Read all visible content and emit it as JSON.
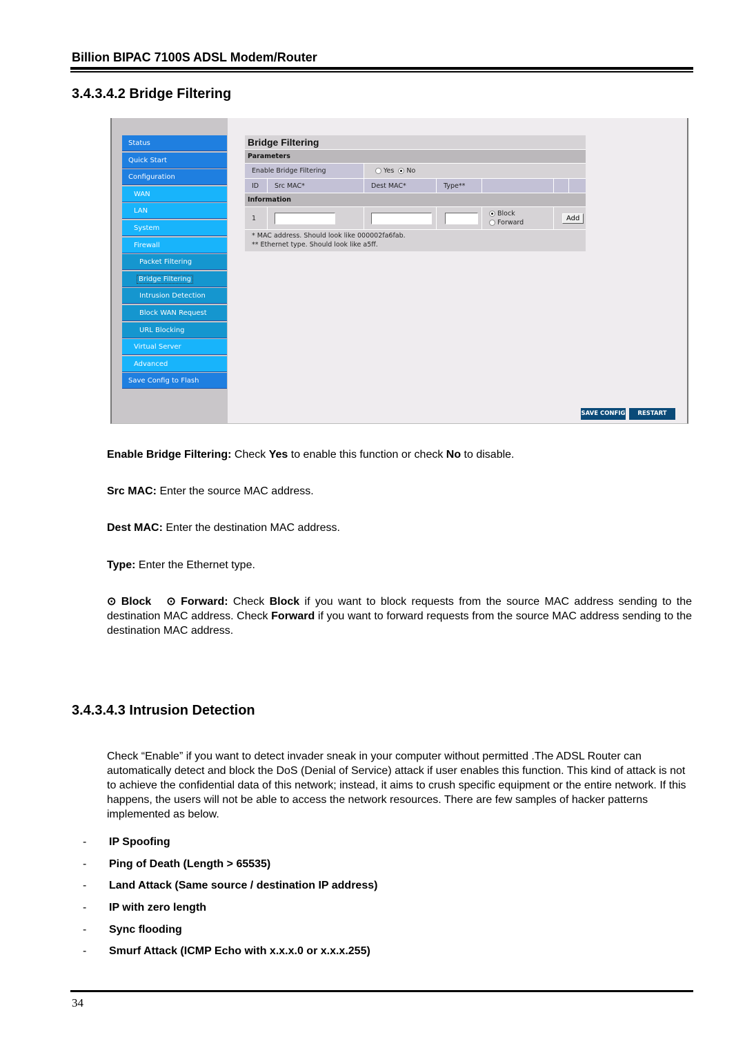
{
  "header": {
    "title": "Billion BIPAC 7100S ADSL Modem/Router"
  },
  "section1": {
    "heading": "3.4.3.4.2 Bridge Filtering"
  },
  "screenshot": {
    "sidebar": {
      "items": [
        {
          "label": "Status",
          "level": 0
        },
        {
          "label": "Quick Start",
          "level": 0
        },
        {
          "label": "Configuration",
          "level": 0
        },
        {
          "label": "WAN",
          "level": 1
        },
        {
          "label": "LAN",
          "level": 1
        },
        {
          "label": "System",
          "level": 1
        },
        {
          "label": "Firewall",
          "level": 1
        },
        {
          "label": "Packet Filtering",
          "level": 2
        },
        {
          "label": "Bridge Filtering",
          "level": 2,
          "active": true
        },
        {
          "label": "Intrusion Detection",
          "level": 2
        },
        {
          "label": "Block WAN Request",
          "level": 2
        },
        {
          "label": "URL Blocking",
          "level": 2
        },
        {
          "label": "Virtual Server",
          "level": 1
        },
        {
          "label": "Advanced",
          "level": 1
        },
        {
          "label": "Save Config to Flash",
          "level": 0
        }
      ]
    },
    "panel": {
      "title": "Bridge Filtering",
      "parameters_label": "Parameters",
      "enable_label": "Enable Bridge Filtering",
      "enable_options": {
        "yes": "Yes",
        "no": "No",
        "selected": "No"
      },
      "columns": {
        "id": "ID",
        "src_mac": "Src MAC*",
        "dest_mac": "Dest MAC*",
        "type": "Type**"
      },
      "information_label": "Information",
      "row": {
        "id": "1",
        "src_mac_value": "",
        "dest_mac_value": "",
        "type_value": "",
        "action_options": {
          "block": "Block",
          "forward": "Forward",
          "selected": "Block"
        },
        "add_label": "Add"
      },
      "notes": [
        "* MAC address. Should look like 000002fa6fab.",
        "** Ethernet type. Should look like a5ff."
      ]
    },
    "buttons": {
      "save_config": "SAVE CONFIG",
      "restart": "RESTART"
    }
  },
  "descriptions": {
    "enable": {
      "term": "Enable Bridge Filtering:",
      "t1": " Check ",
      "b1": "Yes",
      "t2": " to enable this function or check ",
      "b2": "No",
      "t3": " to disable."
    },
    "src": {
      "term": "Src MAC:",
      "text": " Enter the source MAC address."
    },
    "dest": {
      "term": "Dest MAC:",
      "text": " Enter the destination MAC address."
    },
    "type": {
      "term": "Type:",
      "text": " Enter the Ethernet type."
    },
    "block_forward": {
      "term": "⊙ Block   ⊙ Forward:",
      "t1": " Check ",
      "b1": "Block",
      "t2": " if you want to block requests from the source MAC address sending to the destination MAC address. Check ",
      "b2": "Forward",
      "t3": " if you want to forward requests from the source MAC address sending to the destination MAC address."
    }
  },
  "section2": {
    "heading": "3.4.3.4.3 Intrusion Detection",
    "intro": "Check “Enable” if you want to detect invader sneak in your computer without permitted .The ADSL Router can automatically detect and block the DoS (Denial of Service) attack if user enables this function. This kind of attack is not to achieve the confidential data of this network; instead, it aims to crush specific equipment or the entire network. If this happens, the users will not be able to access the network resources. There are few samples of hacker patterns implemented as below.",
    "patterns": [
      "IP Spoofing",
      "Ping of Death (Length > 65535)",
      "Land Attack (Same source / destination IP address)",
      "IP with zero length",
      "Sync flooding",
      "Smurf Attack (ICMP Echo with x.x.x.0 or x.x.x.255)"
    ],
    "bullet": "-"
  },
  "footer": {
    "page_number": "34"
  }
}
